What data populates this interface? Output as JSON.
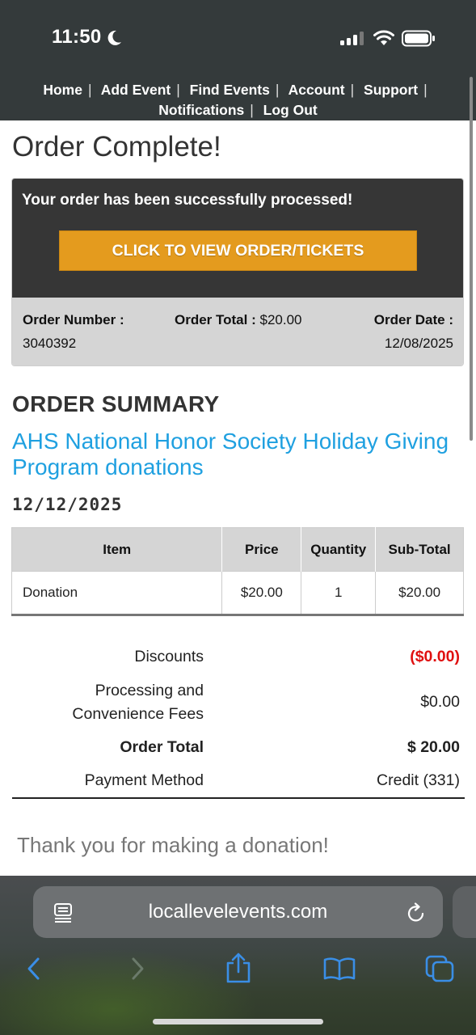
{
  "status_bar": {
    "time": "11:50"
  },
  "nav": {
    "row1": [
      "Home",
      "Add Event",
      "Find Events",
      "Account",
      "Support"
    ],
    "row2": [
      "Notifications",
      "Log Out"
    ]
  },
  "page": {
    "title": "Order Complete!",
    "success_message": "Your order has been successfully processed!",
    "view_button": "CLICK TO VIEW ORDER/TICKETS",
    "order_number_label": "Order Number :",
    "order_number": "3040392",
    "order_total_label": "Order Total :",
    "order_total": "$20.00",
    "order_date_label": "Order Date :",
    "order_date": "12/08/2025"
  },
  "summary": {
    "heading": "ORDER SUMMARY",
    "event_name": "AHS National Honor Society Holiday Giving Program donations",
    "event_date": "12/12/2025",
    "columns": [
      "Item",
      "Price",
      "Quantity",
      "Sub-Total"
    ],
    "rows": [
      {
        "item": "Donation",
        "price": "$20.00",
        "quantity": "1",
        "subtotal": "$20.00"
      }
    ]
  },
  "totals": {
    "discounts_label": "Discounts",
    "discounts_value": "($0.00)",
    "fees_label_1": "Processing and",
    "fees_label_2": "Convenience Fees",
    "fees_value": "$0.00",
    "order_total_label": "Order Total",
    "order_total_value": "$ 20.00",
    "payment_label": "Payment Method",
    "payment_value": "Credit (331)"
  },
  "thanks": "Thank you for making a donation!",
  "browser": {
    "url": "locallevelevents.com"
  },
  "colors": {
    "accent_button": "#e49b1e",
    "link": "#1fa0e0",
    "discount_red": "#e01010",
    "ios_blue": "#3a8ee6"
  }
}
